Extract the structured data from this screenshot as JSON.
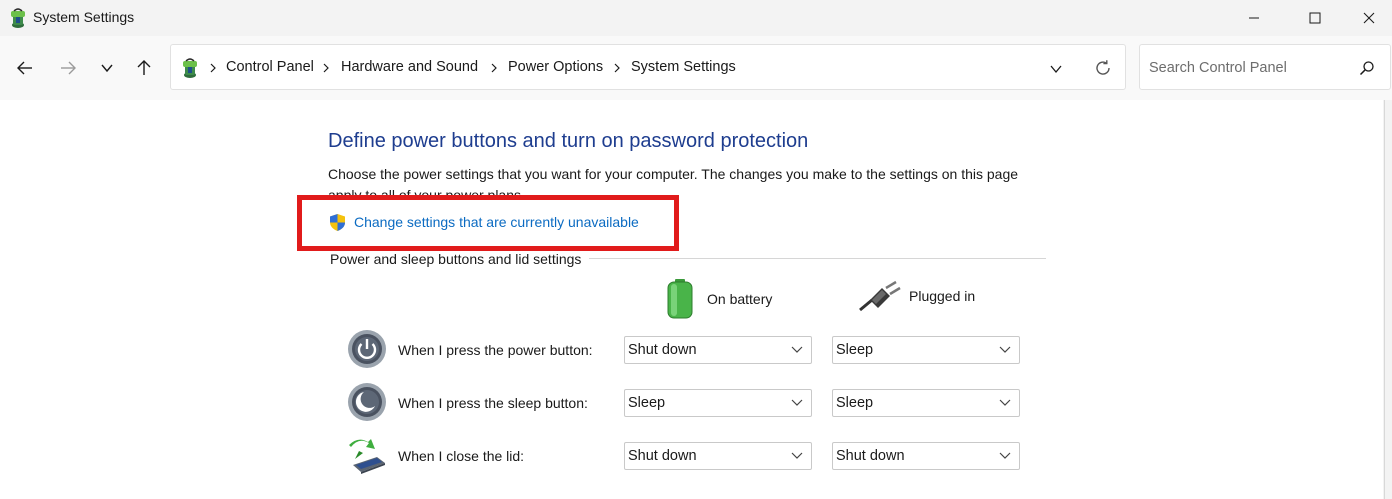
{
  "window": {
    "title": "System Settings",
    "minimize_glyph": "—",
    "maximize_glyph": "☐",
    "close_glyph": "✕"
  },
  "nav": {
    "back_icon": "arrow-left-icon",
    "forward_icon": "arrow-right-icon",
    "recent_icon": "chevron-down-icon",
    "up_icon": "arrow-up-icon"
  },
  "breadcrumb": [
    "Control Panel",
    "Hardware and Sound",
    "Power Options",
    "System Settings"
  ],
  "search": {
    "placeholder": "Search Control Panel"
  },
  "main": {
    "title": "Define power buttons and turn on password protection",
    "description": "Choose the power settings that you want for your computer. The changes you make to the settings on this page apply to all of your power plans.",
    "change_link": "Change settings that are currently unavailable",
    "section_label": "Power and sleep buttons and lid settings",
    "col_battery": "On battery",
    "col_plugged": "Plugged in",
    "rows": [
      {
        "label": "When I press the power button:",
        "battery": "Shut down",
        "plugged": "Sleep",
        "icon": "power-button-icon"
      },
      {
        "label": "When I press the sleep button:",
        "battery": "Sleep",
        "plugged": "Sleep",
        "icon": "sleep-button-icon"
      },
      {
        "label": "When I close the lid:",
        "battery": "Shut down",
        "plugged": "Shut down",
        "icon": "laptop-lid-icon"
      }
    ]
  },
  "colors": {
    "title_blue": "#1e3d8f",
    "link_blue": "#0b6bc2",
    "highlight_red": "#e11b1b"
  }
}
